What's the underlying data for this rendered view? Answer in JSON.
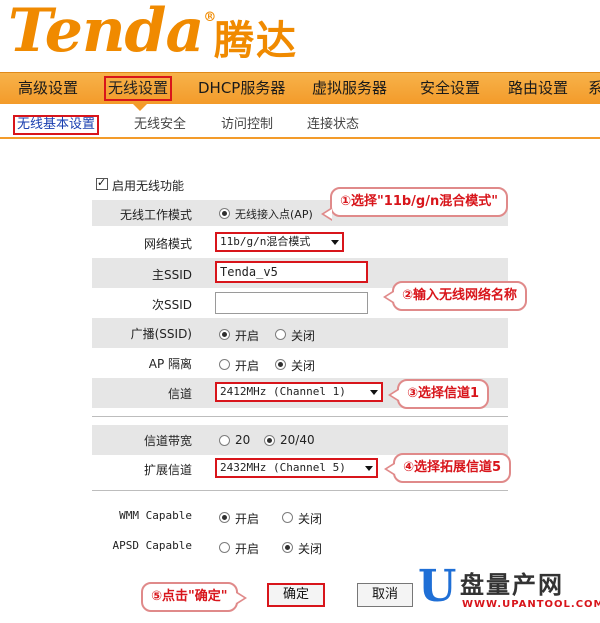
{
  "brand": {
    "logo_en": "Tenda",
    "logo_cn": "腾达",
    "registered": "®"
  },
  "main_nav": [
    "高级设置",
    "无线设置",
    "DHCP服务器",
    "虚拟服务器",
    "安全设置",
    "路由设置",
    "系"
  ],
  "sub_nav": [
    "无线基本设置",
    "无线安全",
    "访问控制",
    "连接状态"
  ],
  "form": {
    "enable_wireless": {
      "label": "启用无线功能",
      "checked": true
    },
    "work_mode": {
      "label": "无线工作模式",
      "option": "无线接入点(AP)",
      "selected": true
    },
    "network_mode": {
      "label": "网络模式",
      "value": "11b/g/n混合模式"
    },
    "primary_ssid": {
      "label": "主SSID",
      "value": "Tenda_v5"
    },
    "secondary_ssid": {
      "label": "次SSID",
      "value": ""
    },
    "broadcast": {
      "label": "广播(SSID)",
      "on_label": "开启",
      "off_label": "关闭",
      "selected": "on"
    },
    "ap_isolation": {
      "label": "AP 隔离",
      "on_label": "开启",
      "off_label": "关闭",
      "selected": "off"
    },
    "channel": {
      "label": "信道",
      "value": "2412MHz (Channel 1)"
    },
    "bandwidth": {
      "label": "信道带宽",
      "opt_20": "20",
      "opt_40": "20/40",
      "selected": "20/40"
    },
    "ext_channel": {
      "label": "扩展信道",
      "value": "2432MHz (Channel 5)"
    },
    "wmm": {
      "label": "WMM Capable",
      "on_label": "开启",
      "off_label": "关闭",
      "selected": "on"
    },
    "apsd": {
      "label": "APSD Capable",
      "on_label": "开启",
      "off_label": "关闭",
      "selected": "off"
    }
  },
  "buttons": {
    "ok": "确定",
    "cancel": "取消"
  },
  "callouts": {
    "c1": "①选择\"11b/g/n混合模式\"",
    "c2": "②输入无线网络名称",
    "c3": "③选择信道1",
    "c4": "④选择拓展信道5",
    "c5": "⑤点击\"确定\""
  },
  "watermark": {
    "letter": "U",
    "name": "盘量产网",
    "url": "WWW.UPANTOOL.COM"
  },
  "colors": {
    "orange": "#f39b2a",
    "highlight_red": "#d8151b",
    "row_gray": "#e6e6e6"
  }
}
